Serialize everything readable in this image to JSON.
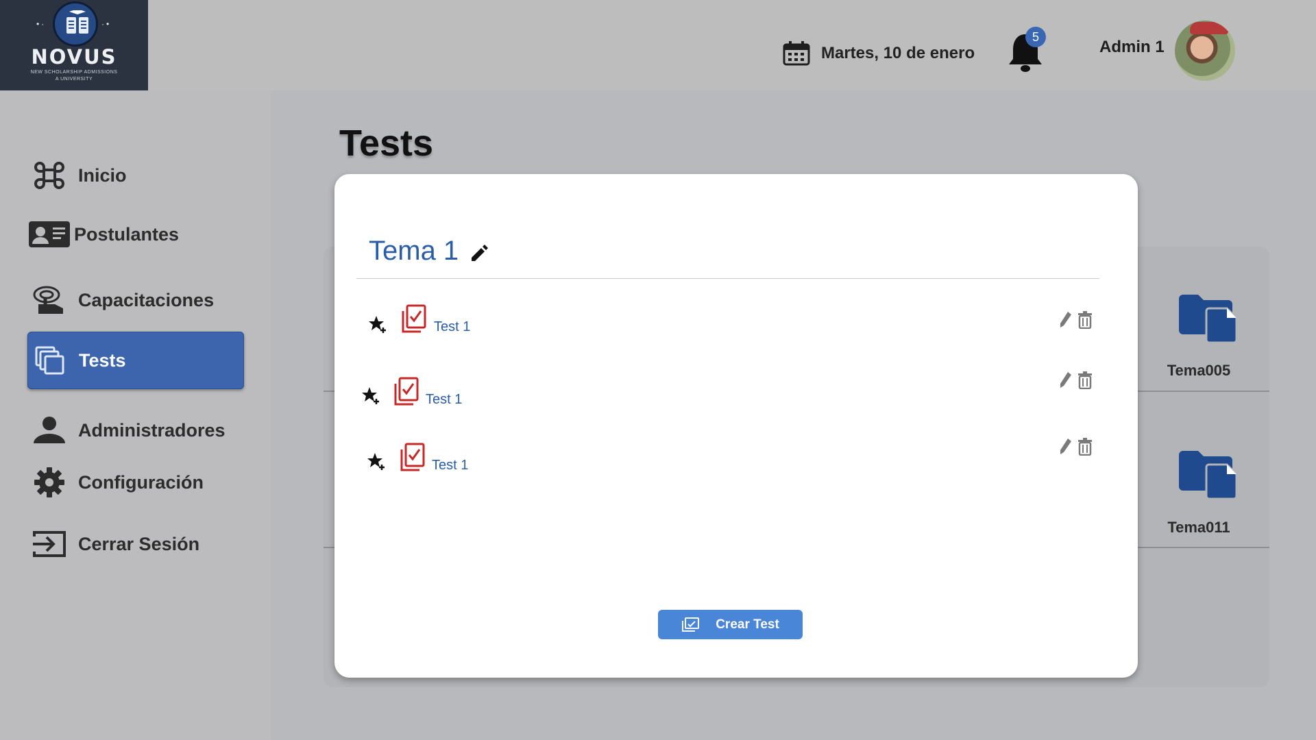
{
  "brand": {
    "name": "NOVUS",
    "tagline_line1": "NEW SCHOLARSHIP ADMISSIONS",
    "tagline_line2": "A UNIVERSITY"
  },
  "header": {
    "date": "Martes, 10 de enero",
    "notifications_count": "5",
    "user_name": "Admin 1"
  },
  "sidebar": {
    "items": [
      {
        "label": "Inicio",
        "icon": "command-icon"
      },
      {
        "label": "Postulantes",
        "icon": "id-card-icon"
      },
      {
        "label": "Capacitaciones",
        "icon": "training-icon"
      },
      {
        "label": "Tests",
        "icon": "tests-icon",
        "active": true
      },
      {
        "label": "Administradores",
        "icon": "person-icon"
      },
      {
        "label": "Configuración",
        "icon": "gear-icon"
      },
      {
        "label": "Cerrar Sesión",
        "icon": "logout-icon"
      }
    ]
  },
  "page": {
    "title": "Tests",
    "folders": [
      {
        "label": "Tema005"
      },
      {
        "label": "Tema011"
      }
    ]
  },
  "modal": {
    "title": "Tema 1",
    "tests": [
      {
        "name": "Test 1"
      },
      {
        "name": "Test 1"
      },
      {
        "name": "Test 1"
      }
    ],
    "create_button_label": "Crear Test"
  },
  "colors": {
    "accent": "#3d65ad",
    "link": "#2a5da8",
    "doc_icon": "#c62828",
    "button": "#4a86d8",
    "folder": "#1f4a8e"
  }
}
